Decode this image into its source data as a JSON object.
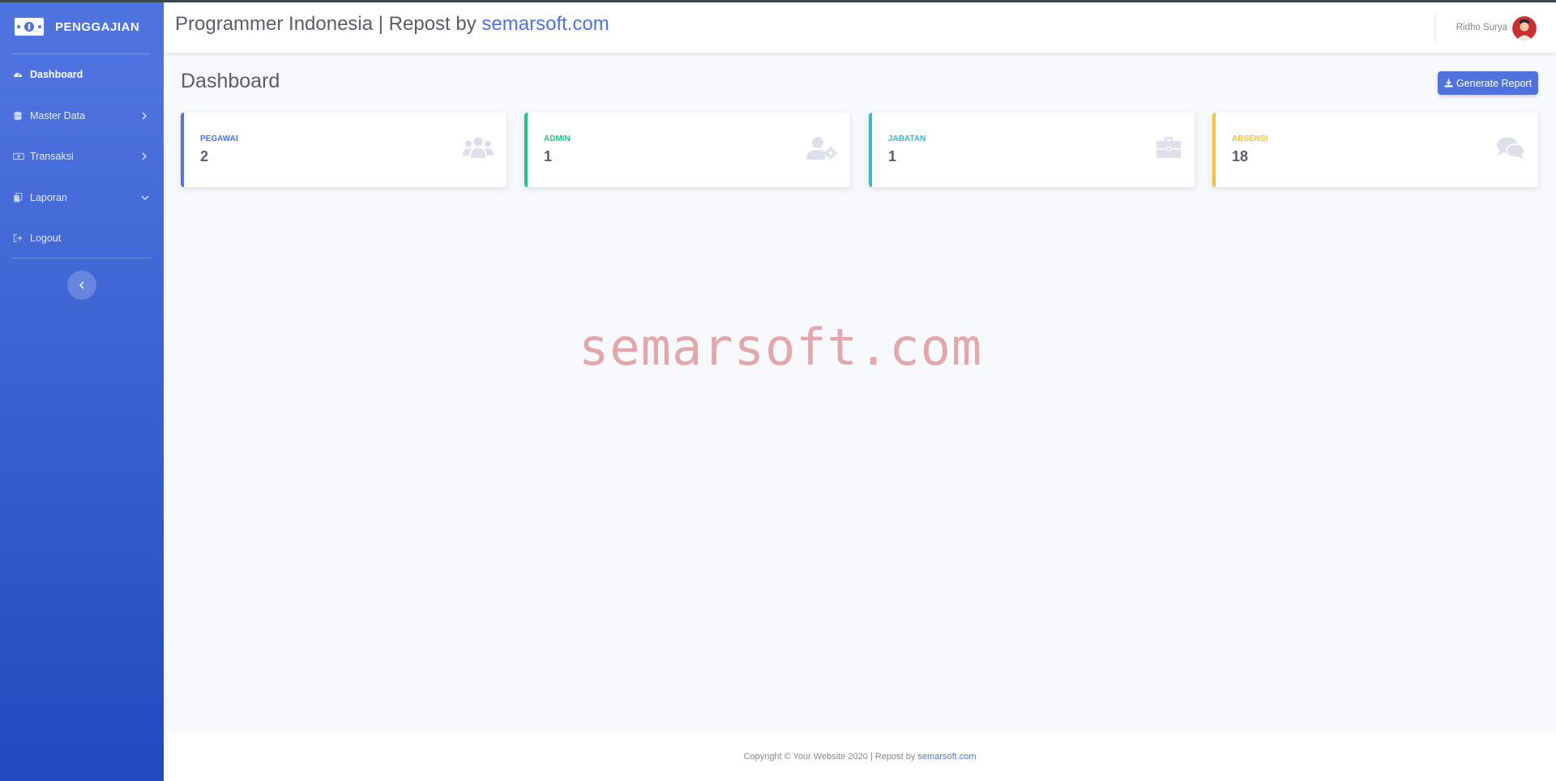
{
  "sidebar": {
    "brand": "PENGGAJIAN",
    "items": [
      {
        "label": "Dashboard",
        "icon": "tachometer-icon",
        "active": true
      },
      {
        "label": "Master Data",
        "icon": "database-icon",
        "arrow": "right"
      },
      {
        "label": "Transaksi",
        "icon": "money-bill-icon",
        "arrow": "right"
      },
      {
        "label": "Laporan",
        "icon": "copy-icon",
        "arrow": "down"
      },
      {
        "label": "Logout",
        "icon": "sign-out-icon"
      }
    ]
  },
  "topbar": {
    "title_prefix": "Programmer Indonesia | Repost by ",
    "title_link": "semarsoft.com",
    "user_name": "Ridho Surya"
  },
  "main": {
    "heading": "Dashboard",
    "generate_button": "Generate Report",
    "cards": [
      {
        "label": "PEGAWAI",
        "value": "2",
        "color": "#4e73df",
        "icon": "users-icon"
      },
      {
        "label": "ADMIN",
        "value": "1",
        "color": "#1cc88a",
        "icon": "user-cog-icon"
      },
      {
        "label": "JABATAN",
        "value": "1",
        "color": "#36b9cc",
        "icon": "briefcase-icon"
      },
      {
        "label": "ABSENSI",
        "value": "18",
        "color": "#f6c23e",
        "icon": "comments-icon"
      }
    ]
  },
  "watermark": "semarsoft.com",
  "footer": {
    "text": "Copyright © Your Website 2020 | Repost by",
    "link": "semarsoft.com"
  },
  "colors": {
    "primary": "#4e73df",
    "sidebar_gradient_end": "#224abe",
    "background": "#f8f9fc",
    "muted_icon": "#dddfeb"
  }
}
